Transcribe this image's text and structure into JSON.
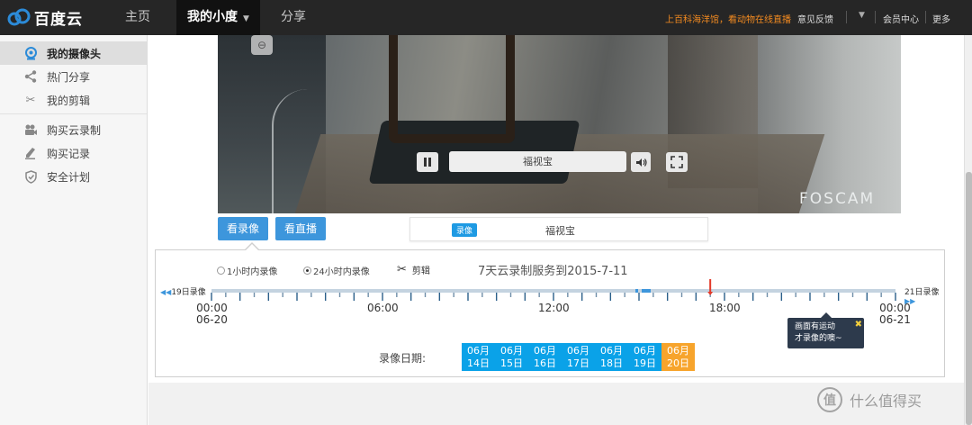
{
  "app": {
    "logo_text": "百度云",
    "nav": [
      {
        "label": "主页"
      },
      {
        "label": "我的小度"
      },
      {
        "label": "分享"
      }
    ],
    "promo": "上百科海洋馆，看动物在线直播",
    "feedback": "意见反馈",
    "member": "会员中心",
    "more": "更多"
  },
  "sidebar": {
    "items": [
      {
        "label": "我的摄像头",
        "icon": "camera-icon"
      },
      {
        "label": "热门分享",
        "icon": "share-icon"
      },
      {
        "label": "我的剪辑",
        "icon": "scissors-icon"
      },
      {
        "label": "购买云录制",
        "icon": "video-camera-icon"
      },
      {
        "label": "购买记录",
        "icon": "pen-icon"
      },
      {
        "label": "安全计划",
        "icon": "shield-icon"
      }
    ]
  },
  "player": {
    "title": "福视宝",
    "watermark": "FOSCAM",
    "zoom_glyph": "⊖"
  },
  "tabs": {
    "recordings": "看录像",
    "live": "看直播"
  },
  "banner": {
    "tag": "录像",
    "name": "福视宝"
  },
  "recording": {
    "options": [
      {
        "label": "1小时内录像",
        "selected": false
      },
      {
        "label": "24小时内录像",
        "selected": true
      }
    ],
    "clip_label": "剪辑",
    "service_text": "7天云录制服务到2015-7-11",
    "prev_day": "19日录像",
    "next_day": "21日录像",
    "time_labels": [
      {
        "time": "00:00",
        "date": "06-20"
      },
      {
        "time": "06:00",
        "date": ""
      },
      {
        "time": "12:00",
        "date": ""
      },
      {
        "time": "18:00",
        "date": ""
      },
      {
        "time": "00:00",
        "date": "06-21"
      }
    ],
    "current_hour": 17.5,
    "motion_tip": [
      "画面有运动",
      "才录像的噢~"
    ],
    "date_label": "录像日期:",
    "dates": [
      {
        "month": "06月",
        "day": "14日",
        "selected": false
      },
      {
        "month": "06月",
        "day": "15日",
        "selected": false
      },
      {
        "month": "06月",
        "day": "16日",
        "selected": false
      },
      {
        "month": "06月",
        "day": "17日",
        "selected": false
      },
      {
        "month": "06月",
        "day": "18日",
        "selected": false
      },
      {
        "month": "06月",
        "day": "19日",
        "selected": false
      },
      {
        "month": "06月",
        "day": "20日",
        "selected": true
      }
    ]
  },
  "watermark_site": "什么值得买",
  "watermark_logo": "值",
  "colors": {
    "topbar": "#262626",
    "accent_blue": "#3d96dc",
    "date_blue": "#0aa2e8",
    "date_selected": "#f7a42c",
    "promo": "#f28a20",
    "cursor_red": "#e23a2a"
  }
}
